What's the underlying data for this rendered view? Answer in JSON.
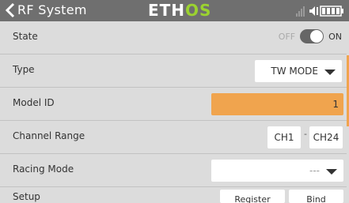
{
  "header": {
    "title": "RF System",
    "logo_part1": "ETH",
    "logo_part2": "OS",
    "back_icon": "chevron-left-icon",
    "status_icons": [
      "signal-icon",
      "speaker-icon",
      "battery-icon"
    ]
  },
  "rows": {
    "state": {
      "label": "State",
      "off_label": "OFF",
      "on_label": "ON",
      "value": "on"
    },
    "type": {
      "label": "Type",
      "value": "TW MODE"
    },
    "model_id": {
      "label": "Model ID",
      "value": "1"
    },
    "channel_range": {
      "label": "Channel Range",
      "start": "CH1",
      "separator": "-",
      "end": "CH24"
    },
    "racing_mode": {
      "label": "Racing Mode",
      "value": "---"
    },
    "setup": {
      "label": "Setup",
      "button1": "Register",
      "button2": "Bind"
    }
  },
  "colors": {
    "accent": "#f0a44e",
    "header_bg": "#6f6f6f",
    "logo_green": "#9bd230",
    "page_bg": "#dcdcdc"
  }
}
